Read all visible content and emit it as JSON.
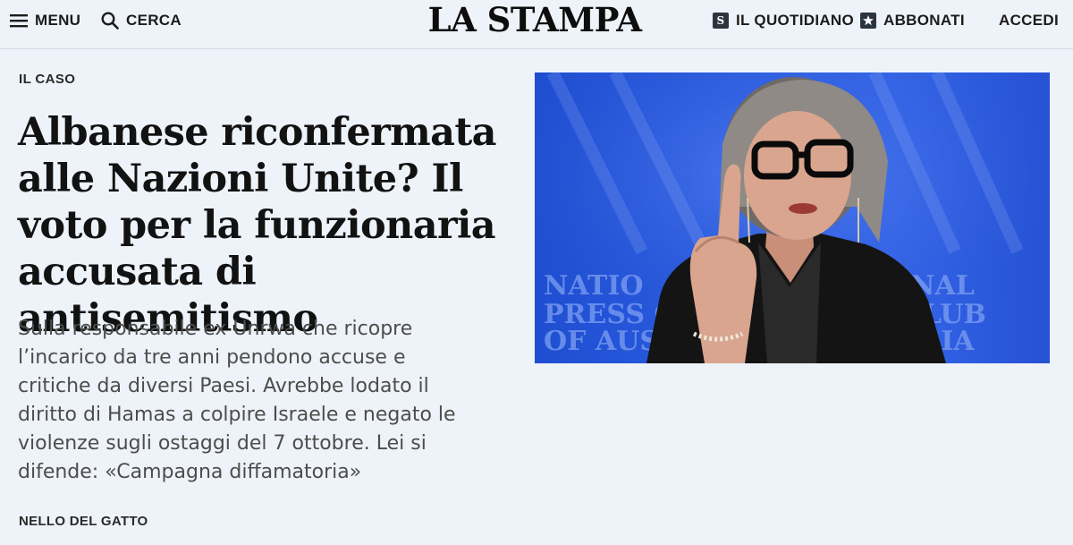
{
  "header": {
    "menu_label": "MENU",
    "search_label": "CERCA",
    "logo": "LA STAMPA",
    "quotidiano_label": "IL QUOTIDIANO",
    "abbonati_label": "ABBONATI",
    "accedi_label": "ACCEDI"
  },
  "article": {
    "kicker": "IL CASO",
    "headline": "Albanese riconfermata alle Nazioni Unite? Il voto per la funzionaria accusata di antisemitismo",
    "summary": "Sulla responsabile ex Unrwa che ricopre l’incarico da tre anni pendono accuse e critiche da diversi Paesi. Avrebbe lodato il diritto di Hamas a colpire Israele e negato le violenze sugli ostaggi del 7 ottobre. Lei si difende: «Campagna diffamatoria»",
    "author": "NELLO DEL GATTO"
  },
  "photo": {
    "backdrop_text": "NATIONAL PRESS CLUB OF AUSTRALIA",
    "colors": {
      "backdrop": "#2d5fe3",
      "jacket": "#141414",
      "skin": "#d9a58f",
      "hair": "#8f8a86"
    }
  },
  "icons": {
    "menu": "hamburger-icon",
    "search": "search-icon",
    "quotidiano": "newspaper-s-icon",
    "abbonati": "star-badge-icon"
  }
}
